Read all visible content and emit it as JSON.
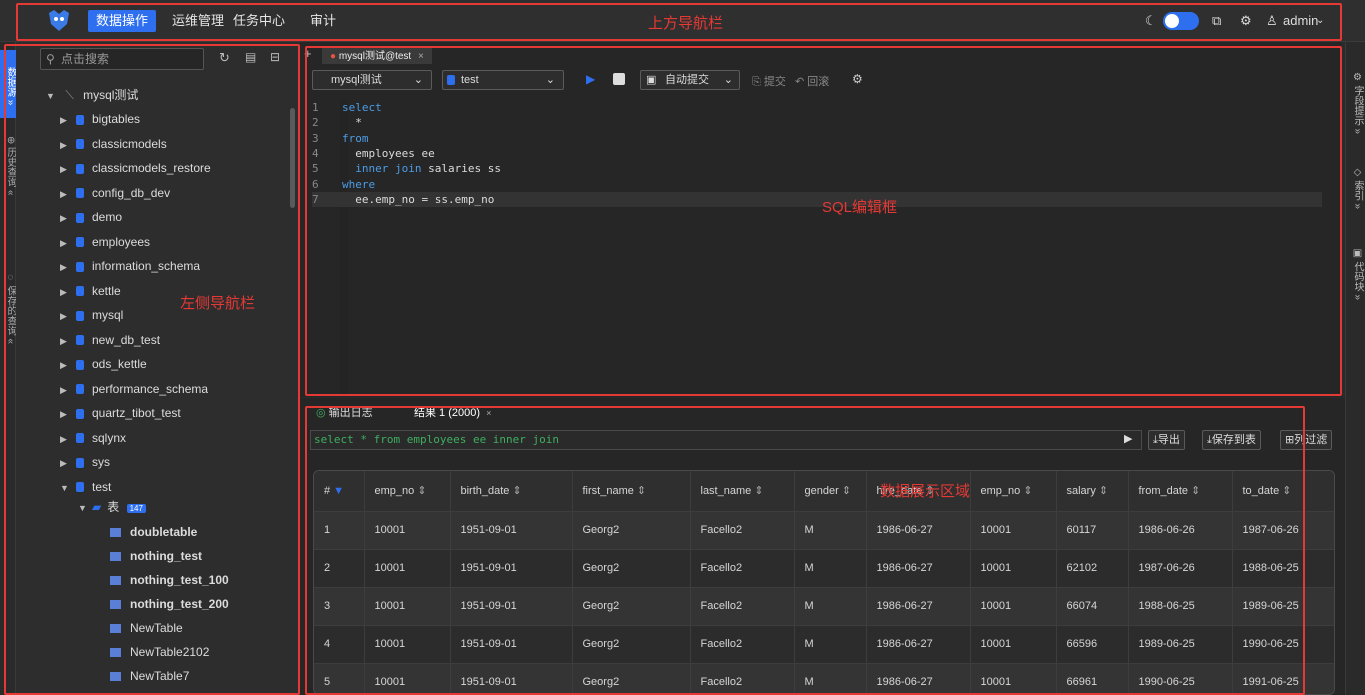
{
  "topnav": {
    "menus": [
      "数据操作",
      "运维管理",
      "任务中心",
      "审计"
    ],
    "user": "admin",
    "annotation": "上方导航栏"
  },
  "left_tabs": [
    "数据源",
    "历史查询",
    "保存的查询"
  ],
  "sidebar": {
    "search_placeholder": "点击搜索",
    "connection": "mysql测试",
    "databases": [
      "bigtables",
      "classicmodels",
      "classicmodels_restore",
      "config_db_dev",
      "demo",
      "employees",
      "information_schema",
      "kettle",
      "mysql",
      "new_db_test",
      "ods_kettle",
      "performance_schema",
      "quartz_tibot_test",
      "sqlynx",
      "sys",
      "test"
    ],
    "table_group_label": "表",
    "table_count": "147",
    "tables": [
      "doubletable",
      "nothing_test",
      "nothing_test_100",
      "nothing_test_200",
      "NewTable",
      "NewTable2102",
      "NewTable7"
    ],
    "annotation": "左侧导航栏"
  },
  "editor": {
    "tab_label": "mysql测试@test",
    "connection_select": "mysql测试",
    "db_select": "test",
    "autocommit_label": "自动提交",
    "commit_label": "提交",
    "rollback_label": "回滚",
    "code": [
      {
        "n": "1",
        "parts": [
          {
            "k": "kw",
            "t": "select"
          }
        ]
      },
      {
        "n": "2",
        "parts": [
          {
            "k": "tx",
            "t": "  *"
          }
        ]
      },
      {
        "n": "3",
        "parts": [
          {
            "k": "kw",
            "t": "from"
          }
        ]
      },
      {
        "n": "4",
        "parts": [
          {
            "k": "tx",
            "t": "  employees ee"
          }
        ]
      },
      {
        "n": "5",
        "parts": [
          {
            "k": "kw",
            "t": "  inner join"
          },
          {
            "k": "tx",
            "t": " salaries ss"
          }
        ]
      },
      {
        "n": "6",
        "parts": [
          {
            "k": "kw",
            "t": "where"
          }
        ]
      },
      {
        "n": "7",
        "parts": [
          {
            "k": "tx",
            "t": "  ee.emp_no = ss.emp_no"
          }
        ]
      }
    ],
    "annotation": "SQL编辑框"
  },
  "right_tabs": [
    "字段提示",
    "索引",
    "代码块"
  ],
  "results": {
    "tab_log": "输出日志",
    "tab_result": "结果 1 (2000)",
    "sql_preview": "select * from employees ee inner join",
    "btn_export": "导出",
    "btn_save": "保存到表",
    "btn_filter": "列过滤",
    "columns": [
      "#",
      "emp_no",
      "birth_date",
      "first_name",
      "last_name",
      "gender",
      "hire_date",
      "emp_no",
      "salary",
      "from_date",
      "to_date"
    ],
    "rows": [
      [
        "1",
        "10001",
        "1951-09-01",
        "Georg2",
        "Facello2",
        "M",
        "1986-06-27",
        "10001",
        "60117",
        "1986-06-26",
        "1987-06-26"
      ],
      [
        "2",
        "10001",
        "1951-09-01",
        "Georg2",
        "Facello2",
        "M",
        "1986-06-27",
        "10001",
        "62102",
        "1987-06-26",
        "1988-06-25"
      ],
      [
        "3",
        "10001",
        "1951-09-01",
        "Georg2",
        "Facello2",
        "M",
        "1986-06-27",
        "10001",
        "66074",
        "1988-06-25",
        "1989-06-25"
      ],
      [
        "4",
        "10001",
        "1951-09-01",
        "Georg2",
        "Facello2",
        "M",
        "1986-06-27",
        "10001",
        "66596",
        "1989-06-25",
        "1990-06-25"
      ],
      [
        "5",
        "10001",
        "1951-09-01",
        "Georg2",
        "Facello2",
        "M",
        "1986-06-27",
        "10001",
        "66961",
        "1990-06-25",
        "1991-06-25"
      ]
    ],
    "annotation": "数据展示区域"
  }
}
